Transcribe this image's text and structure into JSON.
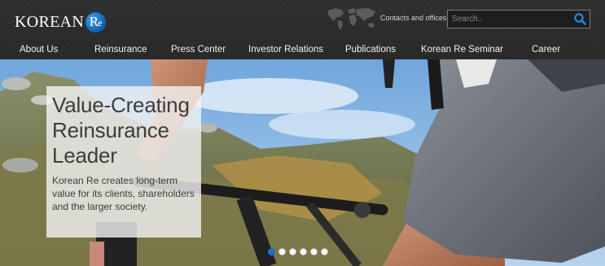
{
  "brand": {
    "name": "KOREAN",
    "mark": "R",
    "mark_e": "e",
    "accent": "#1a72d0"
  },
  "header": {
    "contacts_label": "Contacts and offices",
    "search": {
      "placeholder": "Search..",
      "value": ""
    }
  },
  "nav": [
    {
      "label": "About Us"
    },
    {
      "label": "Reinsurance"
    },
    {
      "label": "Press Center"
    },
    {
      "label": "Investor Relations"
    },
    {
      "label": "Publications"
    },
    {
      "label": "Korean Re Seminar"
    },
    {
      "label": "Career"
    }
  ],
  "hero": {
    "title_lines": [
      "Value-Creating",
      "Reinsurance",
      "Leader"
    ],
    "text": "Korean Re creates long-term value for its clients, shareholders and the larger society.",
    "slides": {
      "count": 6,
      "active": 1
    }
  },
  "icons": [
    "world-map-icon",
    "search-icon"
  ]
}
